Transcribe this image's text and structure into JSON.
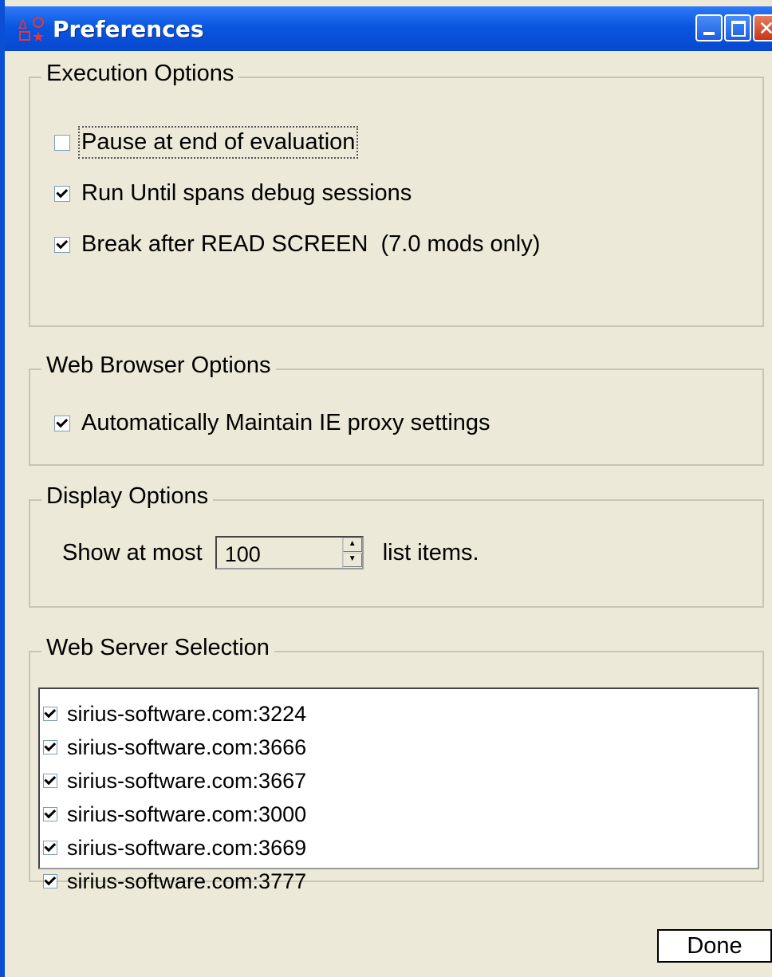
{
  "window": {
    "title": "Preferences"
  },
  "execution": {
    "legend": "Execution Options",
    "options": [
      {
        "label": "Pause at end of evaluation",
        "checked": false
      },
      {
        "label": "Run Until spans debug sessions",
        "checked": true
      },
      {
        "label": "Break after READ SCREEN  (7.0 mods only)",
        "checked": true
      }
    ]
  },
  "browser": {
    "legend": "Web Browser Options",
    "option": {
      "label": "Automatically Maintain IE proxy settings",
      "checked": true
    }
  },
  "display": {
    "legend": "Display Options",
    "prefix": "Show at most",
    "value": "100",
    "suffix": "list items."
  },
  "servers": {
    "legend": "Web Server Selection",
    "items": [
      {
        "label": "sirius-software.com:3224",
        "checked": true
      },
      {
        "label": "sirius-software.com:3666",
        "checked": true
      },
      {
        "label": "sirius-software.com:3667",
        "checked": true
      },
      {
        "label": "sirius-software.com:3000",
        "checked": true
      },
      {
        "label": "sirius-software.com:3669",
        "checked": true
      },
      {
        "label": "sirius-software.com:3777",
        "checked": true
      }
    ]
  },
  "buttons": {
    "done": "Done"
  }
}
